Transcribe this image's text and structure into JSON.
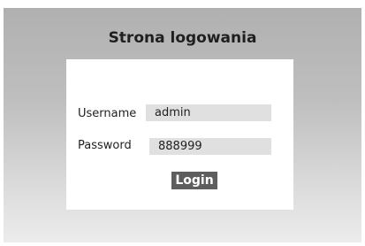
{
  "page": {
    "title": "Strona logowania"
  },
  "form": {
    "username_label": "Username",
    "username_value": "admin",
    "password_label": "Password",
    "password_value": "888999",
    "login_label": "Login"
  }
}
